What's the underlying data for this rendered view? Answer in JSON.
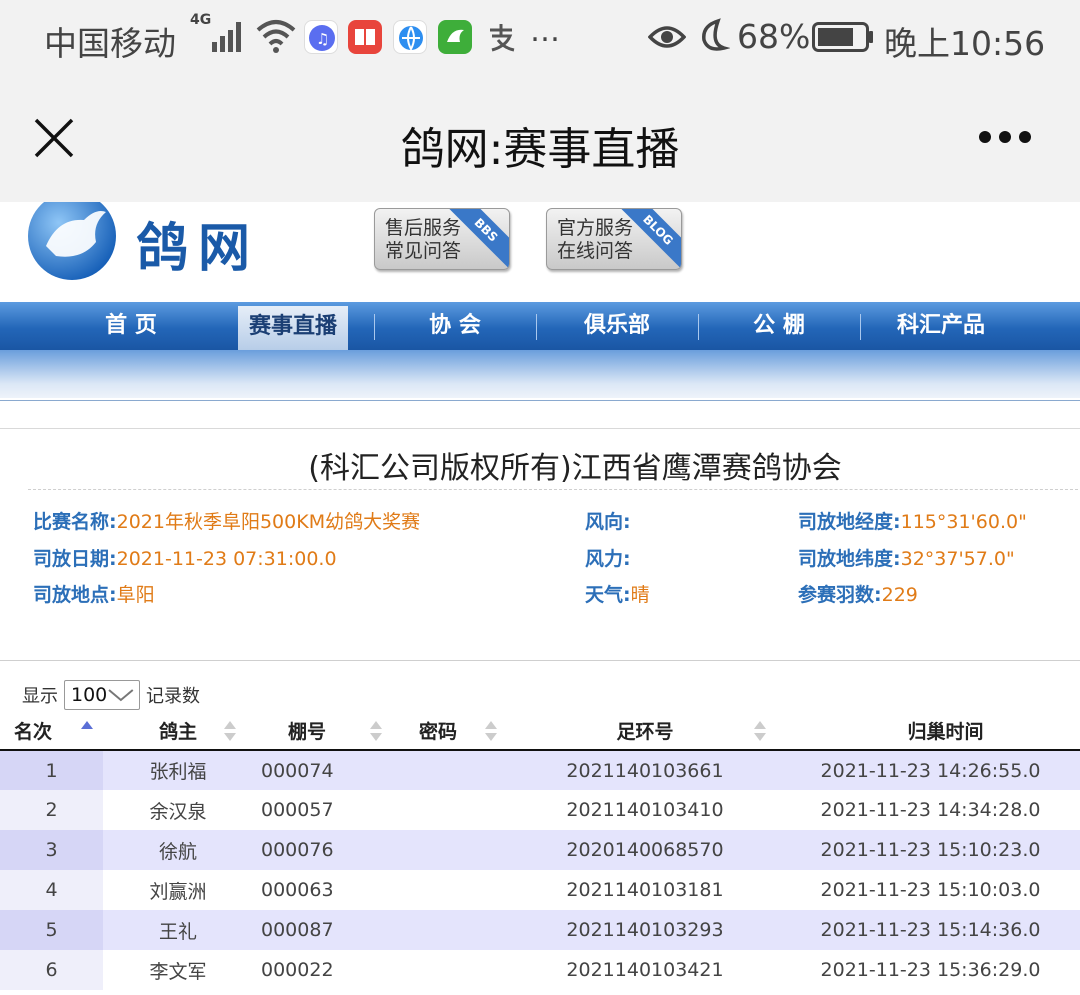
{
  "status_bar": {
    "carrier": "中国移动",
    "network": "4G",
    "more": "…",
    "battery": "68%",
    "time": "晚上10:56",
    "app_icons": [
      "music-icon",
      "book-icon",
      "browser-icon",
      "chinaxinge-icon",
      "alipay-icon"
    ]
  },
  "titlebar": {
    "title": "鸽网:赛事直播"
  },
  "site": {
    "logo_text": "鸽网",
    "header_buttons": [
      {
        "lines": [
          "售后服务",
          "常见问答"
        ],
        "tag": "BBS"
      },
      {
        "lines": [
          "官方服务",
          "在线问答"
        ],
        "tag": "BLOG"
      }
    ],
    "nav": [
      "首 页",
      "赛事直播",
      "协 会",
      "俱乐部",
      "公 棚",
      "科汇产品"
    ],
    "nav_active_index": 1
  },
  "race": {
    "heading": "(科汇公司版权所有)江西省鹰潭赛鸽协会",
    "info": {
      "name_k": "比赛名称:",
      "name_v": "2021年秋季阜阳500KM幼鸽大奖赛",
      "date_k": "司放日期:",
      "date_v": "2021-11-23 07:31:00.0",
      "place_k": "司放地点:",
      "place_v": "阜阳",
      "wind_dir_k": "风向:",
      "wind_dir_v": "",
      "wind_k": "风力:",
      "wind_v": "",
      "weather_k": "天气:",
      "weather_v": "晴",
      "lon_k": "司放地经度:",
      "lon_v": "115°31'60.0\"",
      "lat_k": "司放地纬度:",
      "lat_v": "32°37'57.0\"",
      "count_k": "参赛羽数:",
      "count_v": "229"
    }
  },
  "table": {
    "length_prefix": "显示",
    "length_value": "100",
    "length_suffix": "记录数",
    "columns": [
      "名次",
      "鸽主",
      "棚号",
      "密码",
      "足环号",
      "归巢时间"
    ],
    "rows": [
      [
        "1",
        "张利福",
        "000074",
        "",
        "2021140103661",
        "2021-11-23 14:26:55.0"
      ],
      [
        "2",
        "余汉泉",
        "000057",
        "",
        "2021140103410",
        "2021-11-23 14:34:28.0"
      ],
      [
        "3",
        "徐航",
        "000076",
        "",
        "2020140068570",
        "2021-11-23 15:10:23.0"
      ],
      [
        "4",
        "刘赢洲",
        "000063",
        "",
        "2021140103181",
        "2021-11-23 15:10:03.0"
      ],
      [
        "5",
        "王礼",
        "000087",
        "",
        "2021140103293",
        "2021-11-23 15:14:36.0"
      ],
      [
        "6",
        "李文军",
        "000022",
        "",
        "2021140103421",
        "2021-11-23 15:36:29.0"
      ]
    ]
  }
}
